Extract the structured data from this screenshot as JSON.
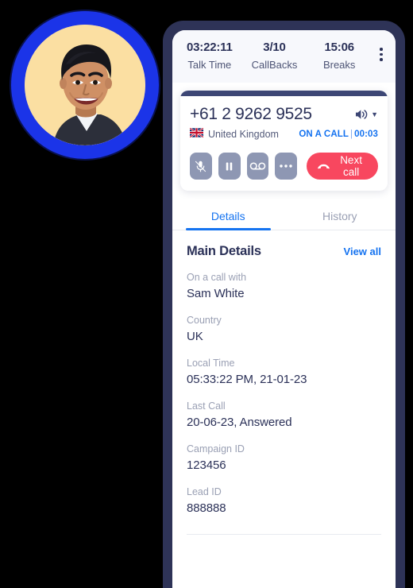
{
  "header": {
    "stats": [
      {
        "value": "03:22:11",
        "label": "Talk Time",
        "name": "talk-time"
      },
      {
        "value": "3/10",
        "label": "CallBacks",
        "name": "callbacks"
      },
      {
        "value": "15:06",
        "label": "Breaks",
        "name": "breaks"
      }
    ],
    "menu_icon": "kebab-menu-icon"
  },
  "call_card": {
    "phone_number": "+61 2 9262 9525",
    "country": "United Kingdom",
    "country_flag": "uk-flag-icon",
    "status_text": "ON A CALL",
    "status_separator": "|",
    "call_duration": "00:03",
    "speaker_icon": "speaker-icon",
    "actions": [
      {
        "name": "mute-button",
        "icon": "mic-muted-icon"
      },
      {
        "name": "hold-button",
        "icon": "pause-icon"
      },
      {
        "name": "voicemail-button",
        "icon": "voicemail-icon"
      },
      {
        "name": "more-options-button",
        "icon": "ellipsis-icon"
      }
    ],
    "next_call_label": "Next call",
    "next_call_icon": "hangup-icon",
    "accent_red": "#f8475f",
    "accent_navy": "#3d4775"
  },
  "tabs": [
    {
      "label": "Details",
      "active": true
    },
    {
      "label": "History",
      "active": false
    }
  ],
  "details": {
    "title": "Main Details",
    "view_all_label": "View all",
    "fields": [
      {
        "label": "On a call with",
        "value": "Sam White"
      },
      {
        "label": "Country",
        "value": "UK"
      },
      {
        "label": "Local Time",
        "value": "05:33:22 PM, 21-01-23"
      },
      {
        "label": "Last Call",
        "value": "20-06-23, Answered"
      },
      {
        "label": "Campaign ID",
        "value": "123456"
      },
      {
        "label": "Lead ID",
        "value": "888888"
      }
    ]
  },
  "avatar": {
    "name": "agent-avatar",
    "ring_color": "#1b34e8",
    "background_color": "#fbdfa2"
  }
}
